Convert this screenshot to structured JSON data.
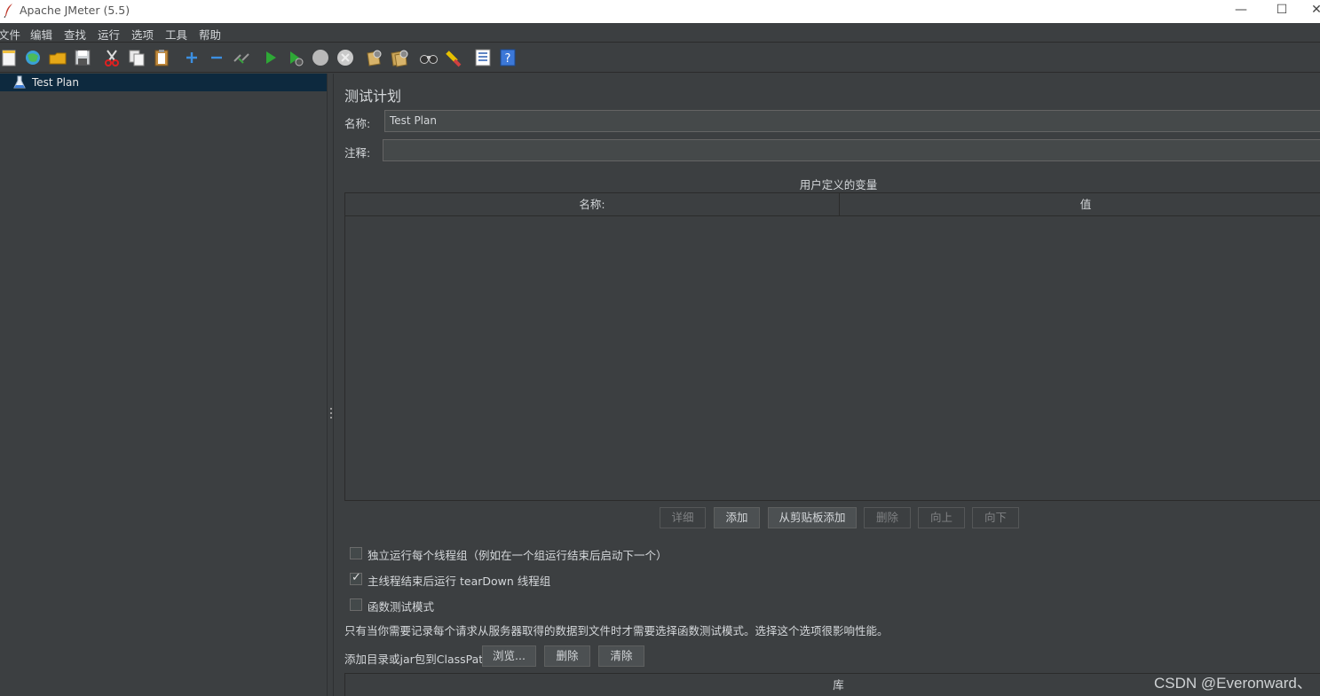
{
  "window": {
    "title": "Apache JMeter (5.5)",
    "minimize": "—",
    "maximize": "☐",
    "close": "✕"
  },
  "menu": [
    "文件",
    "编辑",
    "查找",
    "运行",
    "选项",
    "工具",
    "帮助"
  ],
  "toolbar": {
    "icons": [
      "new-icon",
      "templates-icon",
      "open-icon",
      "save-icon",
      "cut-icon",
      "copy-icon",
      "paste-icon",
      "expand-icon",
      "collapse-icon",
      "toggle-icon",
      "start-icon",
      "start-no-pauses-icon",
      "stop-icon",
      "shutdown-icon",
      "clear-icon",
      "clear-all-icon",
      "search-icon",
      "reset-search-icon",
      "function-helper-icon",
      "help-icon"
    ]
  },
  "tree": {
    "items": [
      {
        "label": "Test Plan",
        "icon": "flask-icon"
      }
    ]
  },
  "plan": {
    "title": "测试计划",
    "name_label": "名称:",
    "name_value": "Test Plan",
    "comment_label": "注释:",
    "comment_value": "",
    "variables_title": "用户定义的变量",
    "columns": [
      "名称:",
      "值"
    ],
    "rows": [],
    "buttons": {
      "detail": "详细",
      "add": "添加",
      "add_clipboard": "从剪贴板添加",
      "delete": "删除",
      "up": "向上",
      "down": "向下"
    },
    "checkboxes": [
      {
        "label": "独立运行每个线程组（例如在一个组运行结束后启动下一个）",
        "checked": false
      },
      {
        "label": "主线程结束后运行 tearDown 线程组",
        "checked": true
      },
      {
        "label": "函数测试模式",
        "checked": false
      }
    ],
    "functional_note": "只有当你需要记录每个请求从服务器取得的数据到文件时才需要选择函数测试模式。选择这个选项很影响性能。",
    "classpath_label": "添加目录或jar包到ClassPath",
    "classpath_buttons": {
      "browse": "浏览...",
      "delete": "删除",
      "clear": "清除"
    },
    "library_column": "库"
  },
  "watermark": "CSDN @Everonward、"
}
